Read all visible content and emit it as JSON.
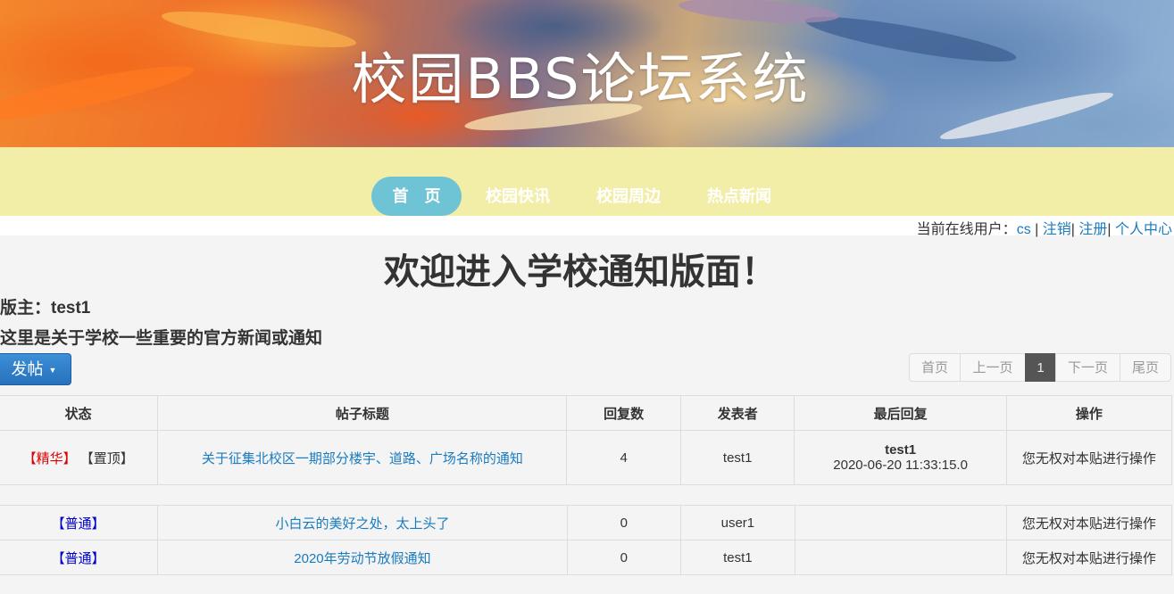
{
  "banner": {
    "title": "校园BBS论坛系统"
  },
  "nav": {
    "items": [
      {
        "label": "首　页",
        "active": true
      },
      {
        "label": "校园快讯",
        "active": false
      },
      {
        "label": "校园周边",
        "active": false
      },
      {
        "label": "热点新闻",
        "active": false
      }
    ]
  },
  "userbar": {
    "prefix": "当前在线用户：",
    "username": "cs",
    "sep1": " | ",
    "logout": "注销",
    "sep2": "| ",
    "register": "注册",
    "sep3": "| ",
    "profile": "个人中心"
  },
  "board": {
    "heading": "欢迎进入学校通知版面！",
    "moderator": "版主：test1",
    "description": "这里是关于学校一些重要的官方新闻或通知"
  },
  "post_button": {
    "label": "发帖"
  },
  "pager": {
    "first": "首页",
    "prev": "上一页",
    "current": "1",
    "next": "下一页",
    "last": "尾页"
  },
  "table": {
    "headers": {
      "status": "状态",
      "title": "帖子标题",
      "replies": "回复数",
      "author": "发表者",
      "last_reply": "最后回复",
      "operation": "操作"
    },
    "top_posts": [
      {
        "tag_elite": "【精华】",
        "tag_top": "【置顶】",
        "title": "关于征集北校区一期部分楼宇、道路、广场名称的通知",
        "replies": "4",
        "author": "test1",
        "last_user": "test1",
        "last_time": "2020-06-20 11:33:15.0",
        "operation": "您无权对本贴进行操作"
      }
    ],
    "normal_posts": [
      {
        "tag": "【普通】",
        "title": "小白云的美好之处，太上头了",
        "replies": "0",
        "author": "user1",
        "last_reply": "",
        "operation": "您无权对本贴进行操作"
      },
      {
        "tag": "【普通】",
        "title": "2020年劳动节放假通知",
        "replies": "0",
        "author": "test1",
        "last_reply": "",
        "operation": "您无权对本贴进行操作"
      }
    ]
  }
}
